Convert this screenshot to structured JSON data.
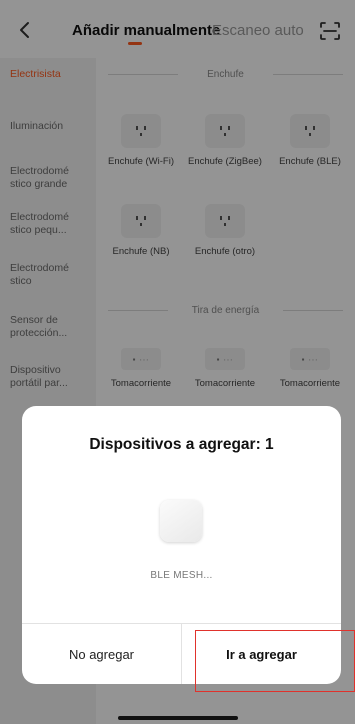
{
  "header": {
    "tab_manual": "Añadir manualmente",
    "tab_auto": "Escaneo auto"
  },
  "colors": {
    "accent": "#ff5a1f",
    "annotation": "#e0322c"
  },
  "sidebar": {
    "items": [
      {
        "label": "Electrisista"
      },
      {
        "label": "Iluminación"
      },
      {
        "label": "Electrodomé stico grande"
      },
      {
        "label": "Electrodomé stico pequ..."
      },
      {
        "label": "Electrodomé stico"
      },
      {
        "label": "Sensor de protección..."
      },
      {
        "label": "Dispositivo portátil par..."
      }
    ]
  },
  "content": {
    "section_plug": "Enchufe",
    "plugs": [
      {
        "label": "Enchufe (Wi-Fi)"
      },
      {
        "label": "Enchufe (ZigBee)"
      },
      {
        "label": "Enchufe (BLE)"
      },
      {
        "label": "Enchufe (NB)"
      },
      {
        "label": "Enchufe (otro)"
      }
    ],
    "section_strip": "Tira de energía",
    "strips": [
      {
        "label": "Tomacorriente"
      },
      {
        "label": "Tomacorriente"
      },
      {
        "label": "Tomacorriente"
      }
    ]
  },
  "dialog": {
    "title": "Dispositivos a agregar: 1",
    "device_name": "BLE MESH...",
    "btn_cancel": "No agregar",
    "btn_confirm": "Ir a agregar"
  }
}
